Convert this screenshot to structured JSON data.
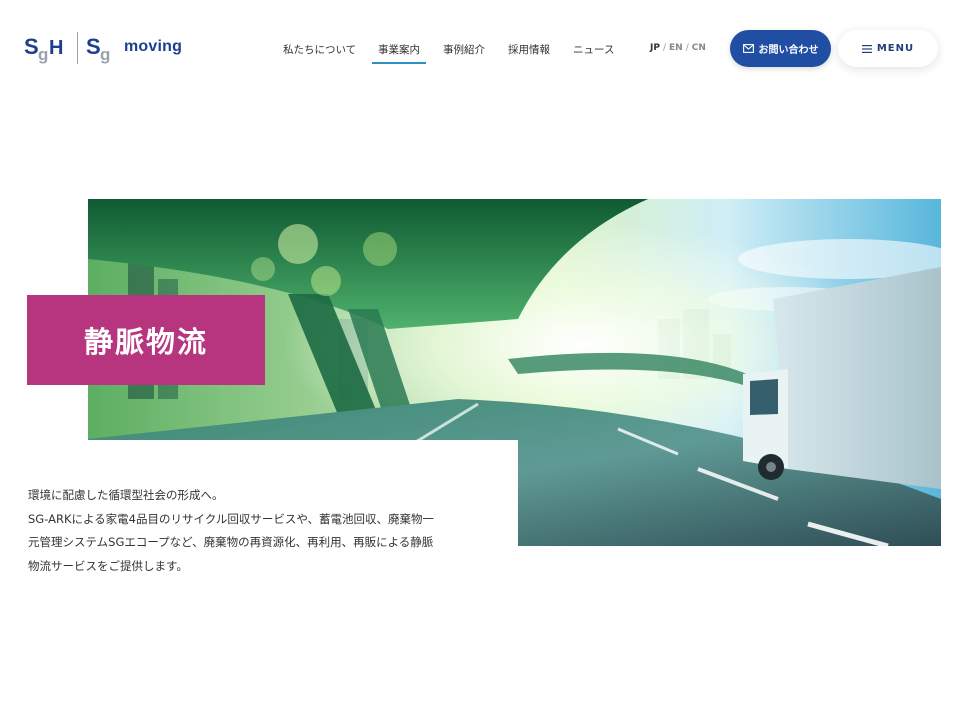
{
  "header": {
    "logo_sgh_text": "SGH",
    "logo_sg_text": "Sg",
    "logo_moving_text": "moving",
    "nav": [
      {
        "label": "私たちについて",
        "active": false
      },
      {
        "label": "事業案内",
        "active": true
      },
      {
        "label": "事例紹介",
        "active": false
      },
      {
        "label": "採用情報",
        "active": false
      },
      {
        "label": "ニュース",
        "active": false
      }
    ],
    "languages": {
      "jp": "JP",
      "en": "EN",
      "cn": "CN",
      "sep": "/"
    },
    "contact_label": "お問い合わせ",
    "menu_label": "MENU"
  },
  "hero": {
    "title": "静脈物流",
    "description_lines": [
      "環境に配慮した循環型社会の形成へ。",
      "SG-ARKによる家電4品目のリサイクル回収サービスや、蓄電池回収、廃棄物一",
      "元管理システムSGエコープなど、廃棄物の再資源化、再利用、再販による静脈",
      "物流サービスをご提供します。"
    ]
  },
  "colors": {
    "brand_blue": "#1f4ea3",
    "accent_magenta": "#b7357e",
    "nav_underline": "#2f8fc4"
  },
  "icons": {
    "contact": "mail-icon",
    "menu": "hamburger-icon"
  }
}
